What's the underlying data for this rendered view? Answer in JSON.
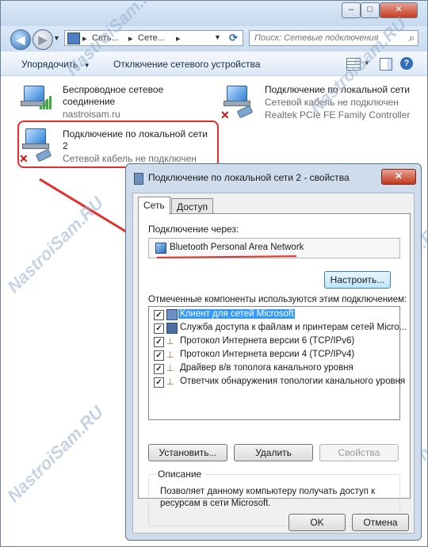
{
  "breadcrumb": {
    "part1": "Сеть...",
    "part2": "Сете..."
  },
  "search": {
    "placeholder": "Поиск: Сетевые подключения"
  },
  "toolbar": {
    "organize": "Упорядочить",
    "disconnect": "Отключение сетевого устройства"
  },
  "connections": [
    {
      "name": "Беспроводное сетевое",
      "name2": "соединение",
      "status": "nastroisam.ru"
    },
    {
      "name": "Подключение по локальной сети",
      "status": "Сетевой кабель не подключен",
      "device": "Realtek PCIe FE Family Controller"
    },
    {
      "name": "Подключение по локальной сети",
      "name2": "2",
      "status": "Сетевой кабель не подключен"
    }
  ],
  "dialog": {
    "title": "Подключение по локальной сети 2 - свойства",
    "close": "✕",
    "tabs": [
      "Сеть",
      "Доступ"
    ],
    "connect_via_label": "Подключение через:",
    "adapter": "Bluetooth Personal Area Network",
    "configure": "Настроить...",
    "components_label": "Отмеченные компоненты используются этим подключением:",
    "components": [
      {
        "label": "Клиент для сетей Microsoft",
        "checked": true,
        "icon": "network-client-icon"
      },
      {
        "label": "Служба доступа к файлам и принтерам сетей Micro...",
        "checked": true,
        "icon": "file-printer-sharing-icon"
      },
      {
        "label": "Протокол Интернета версии 6 (TCP/IPv6)",
        "checked": true,
        "icon": "protocol-icon"
      },
      {
        "label": "Протокол Интернета версии 4 (TCP/IPv4)",
        "checked": true,
        "icon": "protocol-icon"
      },
      {
        "label": "Драйвер в/в тополога канального уровня",
        "checked": true,
        "icon": "protocol-icon"
      },
      {
        "label": "Ответчик обнаружения топологии канального уровня",
        "checked": true,
        "icon": "protocol-icon"
      }
    ],
    "install": "Установить...",
    "remove": "Удалить",
    "properties": "Свойства",
    "description_title": "Описание",
    "description": "Позволяет данному компьютеру получать доступ к ресурсам в сети Microsoft.",
    "ok": "OK",
    "cancel": "Отмена"
  },
  "watermark": "NastroiSam.RU",
  "colors": {
    "highlight": "#e0312e",
    "selection": "#3399ff"
  }
}
